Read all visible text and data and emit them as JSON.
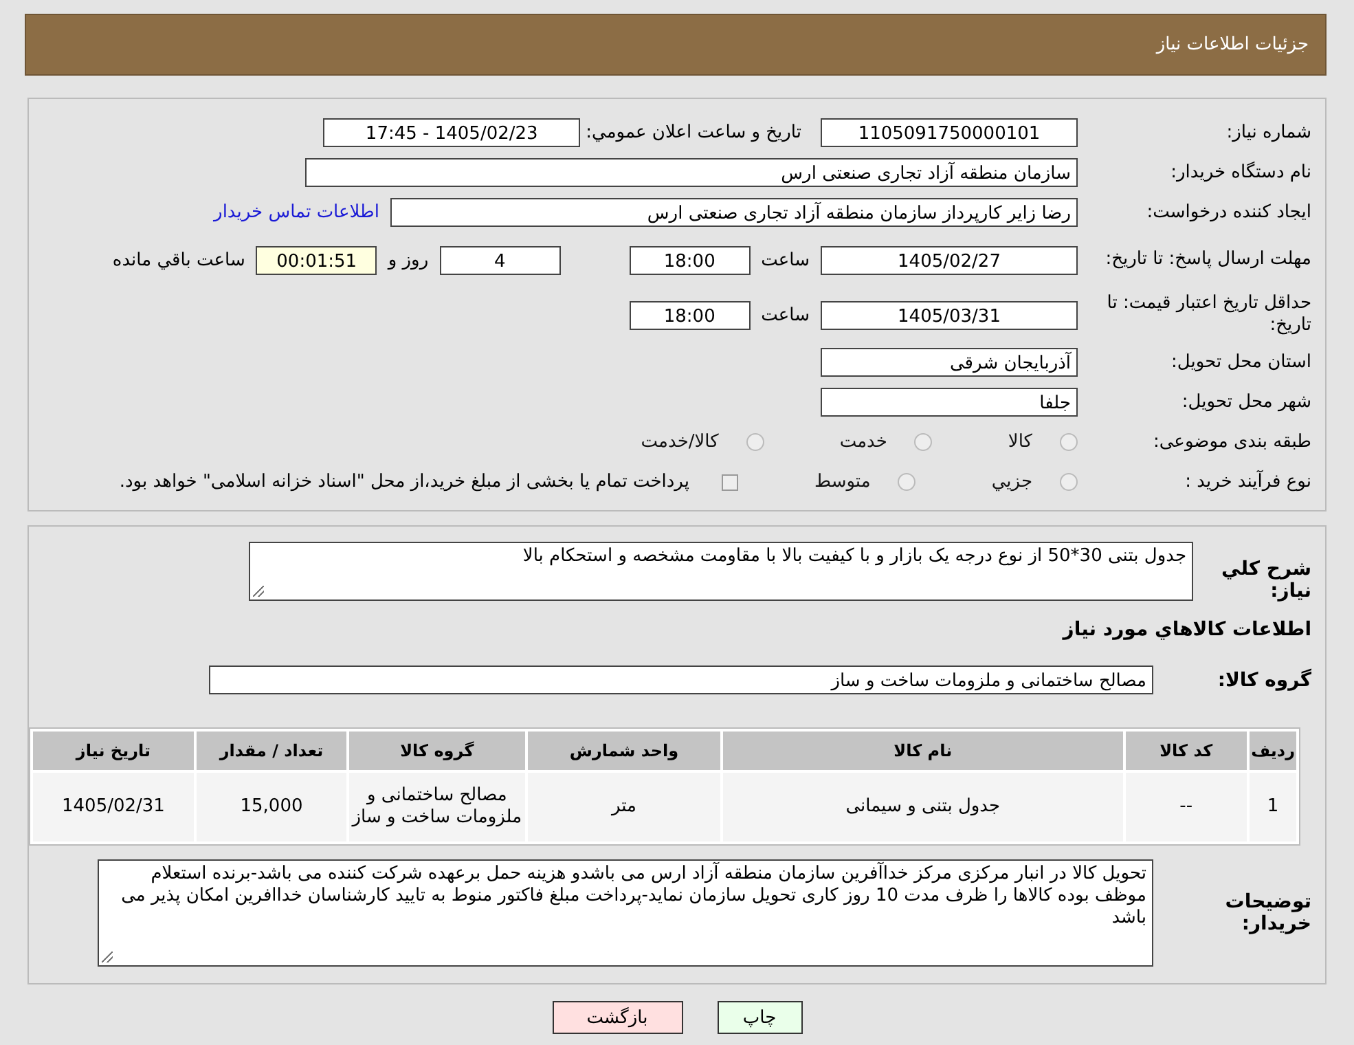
{
  "header": {
    "title": "جزئیات اطلاعات نیاز"
  },
  "need_number": {
    "label": "شماره نیاز:",
    "value": "1105091750000101"
  },
  "announce": {
    "label": "تاریخ و ساعت اعلان عمومي:",
    "value": "1405/02/23 - 17:45"
  },
  "buyer": {
    "label": "نام دستگاه خریدار:",
    "value": "سازمان منطقه آزاد تجاری صنعتی ارس"
  },
  "creator": {
    "label": "ایجاد کننده درخواست:",
    "value": "رضا زایر کارپرداز سازمان منطقه آزاد تجاری صنعتی ارس",
    "link": "اطلاعات تماس خریدار"
  },
  "deadline": {
    "label": "مهلت ارسال پاسخ: تا تاریخ:",
    "date": "1405/02/27",
    "time_label": "ساعت",
    "time": "18:00",
    "days": "4",
    "days_label": "روز و",
    "remaining": "00:01:51",
    "remaining_label": "ساعت باقي مانده"
  },
  "validity": {
    "label": "حداقل تاریخ اعتبار قیمت: تا تاریخ:",
    "date": "1405/03/31",
    "time_label": "ساعت",
    "time": "18:00"
  },
  "province": {
    "label": "استان محل تحویل:",
    "value": "آذربایجان شرقی"
  },
  "city": {
    "label": "شهر محل تحویل:",
    "value": "جلفا"
  },
  "category": {
    "label": "طبقه بندی موضوعی:",
    "options": [
      {
        "label": "کالا",
        "selected": false
      },
      {
        "label": "خدمت",
        "selected": false
      },
      {
        "label": "کالا/خدمت",
        "selected": false
      }
    ]
  },
  "process": {
    "label": "نوع فرآیند خرید :",
    "options": [
      {
        "label": "جزيي",
        "selected": false
      },
      {
        "label": "متوسط",
        "selected": false
      }
    ],
    "checkbox": {
      "label": "پرداخت تمام یا بخشی از مبلغ خرید،از محل \"اسناد خزانه اسلامی\" خواهد بود.",
      "checked": false
    }
  },
  "description": {
    "label": "شرح کلي نیاز:",
    "value": "جدول بتنی 30*50 از نوع درجه یک بازار و با کیفیت بالا با مقاومت مشخصه و استحکام بالا"
  },
  "goods_title": "اطلاعات کالاهاي مورد نیاز",
  "group": {
    "label": "گروه کالا:",
    "value": "مصالح ساختمانی و ملزومات ساخت و ساز"
  },
  "table": {
    "columns": [
      "ردیف",
      "کد کالا",
      "نام کالا",
      "واحد شمارش",
      "گروه کالا",
      "تعداد / مقدار",
      "تاریخ نیاز"
    ],
    "rows": [
      [
        "1",
        "--",
        "جدول بتنی و سیمانی",
        "متر",
        "مصالح ساختمانی و ملزومات ساخت و ساز",
        "15,000",
        "1405/02/31"
      ]
    ]
  },
  "notes": {
    "label": "توضیحات خریدار:",
    "value": "تحویل کالا در انبار مرکزی مرکز خداآفرین سازمان منطقه آزاد ارس می باشدو هزینه حمل برعهده شرکت کننده می باشد-برنده استعلام موظف بوده کالاها را ظرف مدت 10 روز کاری تحویل سازمان نماید-پرداخت مبلغ فاکتور منوط به تایید کارشناسان خداافرین امکان پذیر می باشد"
  },
  "buttons": [
    {
      "label": "چاپ",
      "kind": "print"
    },
    {
      "label": "بازگشت",
      "kind": "back"
    }
  ]
}
